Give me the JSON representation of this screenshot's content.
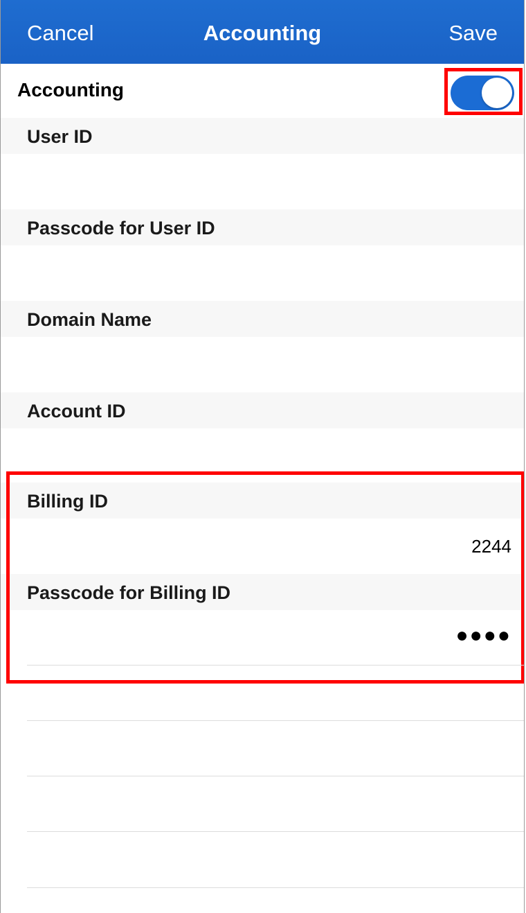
{
  "nav": {
    "cancel_label": "Cancel",
    "title": "Accounting",
    "save_label": "Save"
  },
  "accounting_toggle": {
    "label": "Accounting",
    "on": true
  },
  "fields": {
    "user_id": {
      "label": "User ID",
      "value": ""
    },
    "passcode_user_id": {
      "label": "Passcode for User ID",
      "value": ""
    },
    "domain_name": {
      "label": "Domain Name",
      "value": ""
    },
    "account_id": {
      "label": "Account ID",
      "value": ""
    },
    "billing_id": {
      "label": "Billing ID",
      "value": "2244"
    },
    "passcode_billing_id": {
      "label": "Passcode for Billing ID",
      "value": "●●●●"
    }
  },
  "colors": {
    "nav_background": "#1a62c6",
    "toggle_on": "#1b6cd4",
    "highlight": "#ff0000"
  }
}
